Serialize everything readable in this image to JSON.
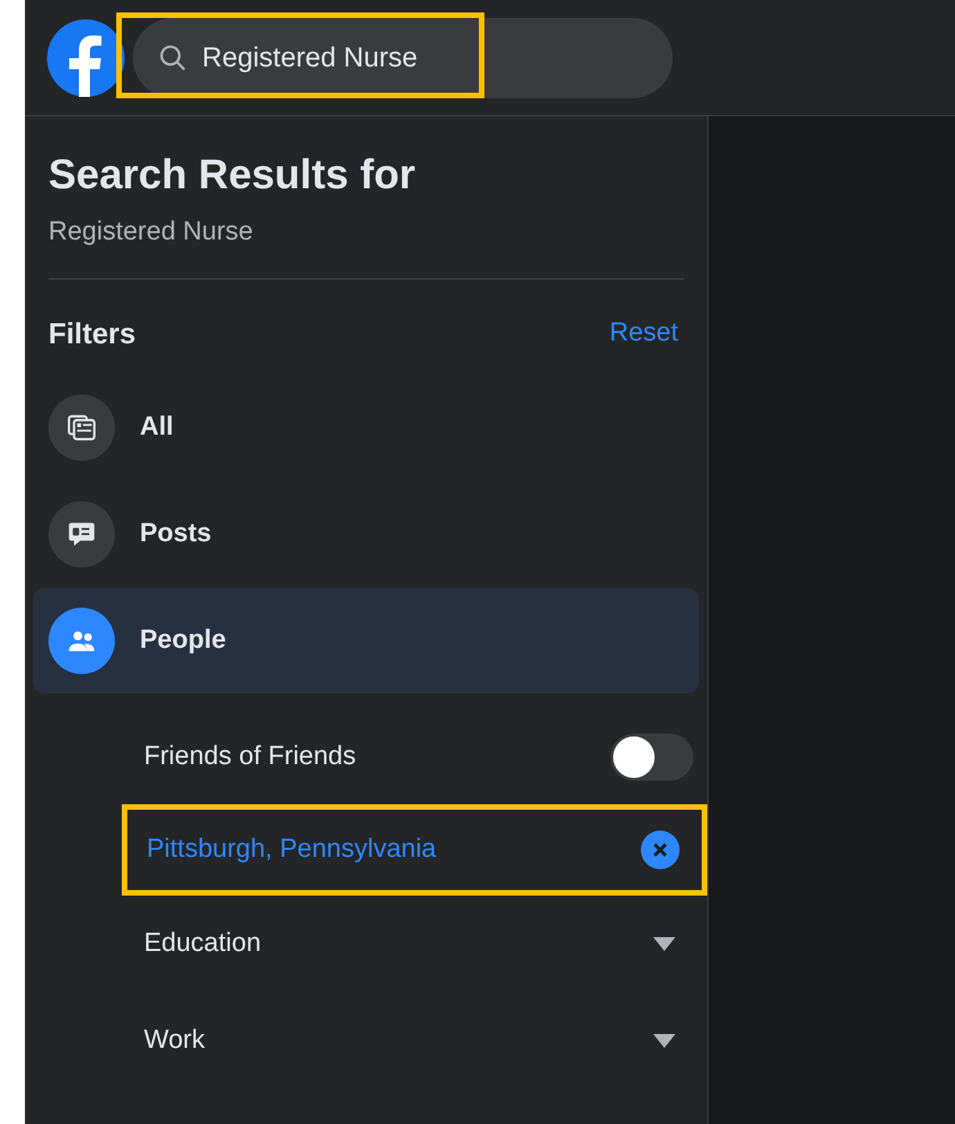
{
  "search": {
    "value": "Registered Nurse",
    "highlighted": true
  },
  "sidebar": {
    "title": "Search Results for",
    "query": "Registered Nurse",
    "filters_label": "Filters",
    "reset": "Reset",
    "categories": [
      {
        "label": "All",
        "selected": false
      },
      {
        "label": "Posts",
        "selected": false
      },
      {
        "label": "People",
        "selected": true
      }
    ],
    "sub_filters": [
      {
        "kind": "toggle",
        "label": "Friends of Friends",
        "on": false
      },
      {
        "kind": "chosen",
        "label": "Pittsburgh, Pennsylvania",
        "highlighted": true
      },
      {
        "kind": "dropdown",
        "label": "Education",
        "expanded": false
      },
      {
        "kind": "dropdown",
        "label": "Work",
        "expanded": false
      }
    ]
  }
}
